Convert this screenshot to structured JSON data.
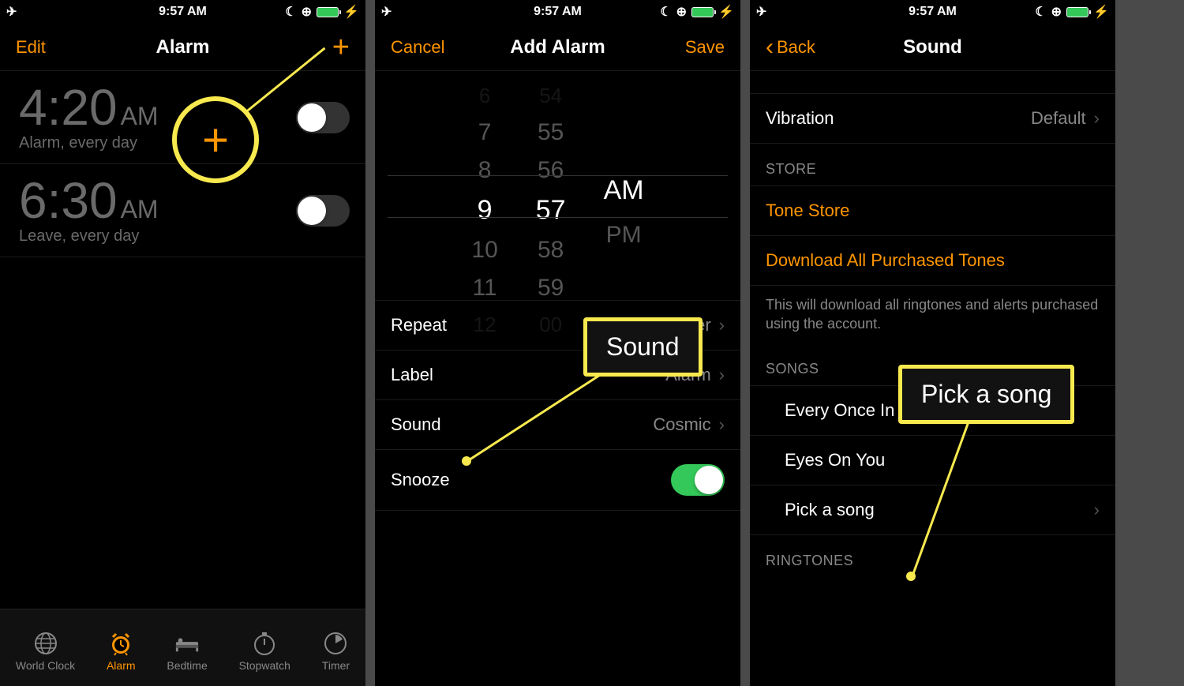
{
  "status_bar": {
    "time": "9:57 AM",
    "moon": "☾",
    "lock": "⊕",
    "charge": "⚡"
  },
  "screen1": {
    "edit": "Edit",
    "title": "Alarm",
    "alarms": [
      {
        "time": "4:20",
        "ampm": "AM",
        "sub": "Alarm, every day"
      },
      {
        "time": "6:30",
        "ampm": "AM",
        "sub": "Leave, every day"
      }
    ],
    "tabs": [
      "World Clock",
      "Alarm",
      "Bedtime",
      "Stopwatch",
      "Timer"
    ]
  },
  "screen2": {
    "cancel": "Cancel",
    "title": "Add Alarm",
    "save": "Save",
    "picker": {
      "hours": [
        "6",
        "7",
        "8",
        "9",
        "10",
        "11",
        "12"
      ],
      "mins": [
        "54",
        "55",
        "56",
        "57",
        "58",
        "59",
        "00"
      ],
      "ampm": [
        "AM",
        "PM"
      ]
    },
    "rows": {
      "repeat": "Repeat",
      "repeat_val": "Never",
      "label": "Label",
      "label_val": "Alarm",
      "sound": "Sound",
      "sound_val": "Cosmic",
      "snooze": "Snooze"
    },
    "annot_sound": "Sound"
  },
  "screen3": {
    "back": "Back",
    "title": "Sound",
    "vibration": "Vibration",
    "vibration_val": "Default",
    "store_header": "STORE",
    "tone_store": "Tone Store",
    "download": "Download All Purchased Tones",
    "download_note": "This will download all ringtones and alerts purchased using the account.",
    "songs_header": "SONGS",
    "songs": [
      "Every Once In A While",
      "Eyes On You",
      "Pick a song"
    ],
    "ringtones_header": "RINGTONES",
    "annot_pick": "Pick a song"
  }
}
